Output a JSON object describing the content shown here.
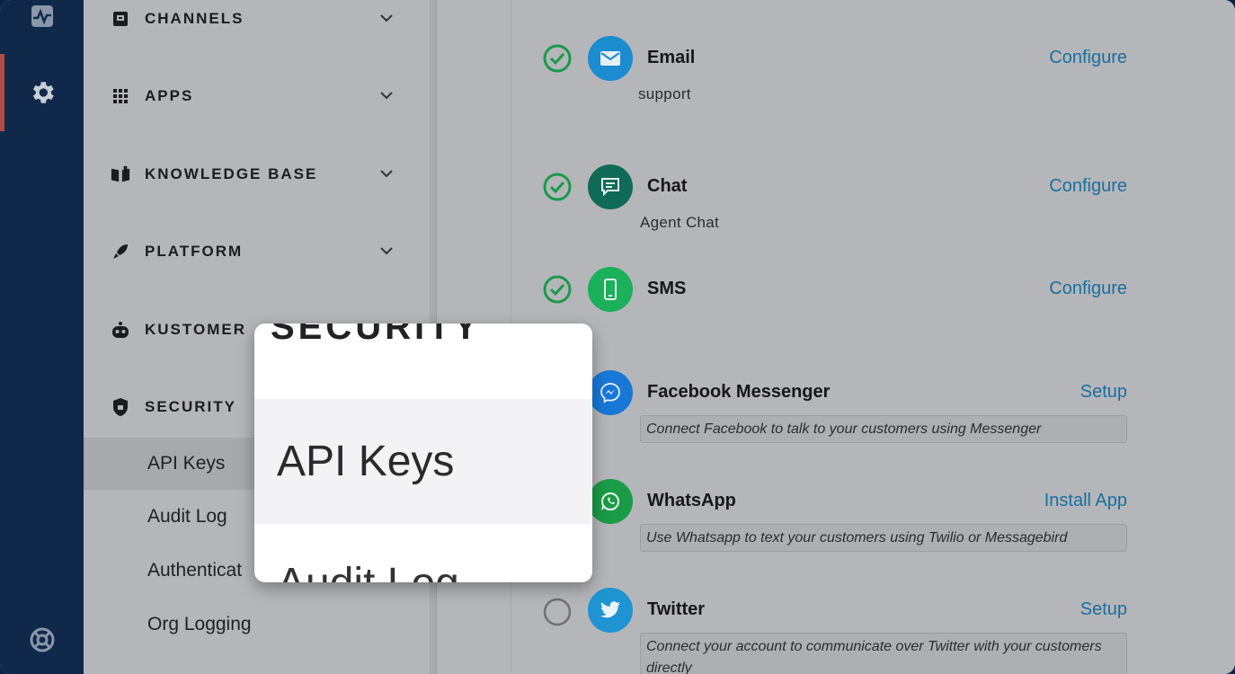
{
  "rail": {
    "items": [
      {
        "icon": "activity-icon"
      },
      {
        "icon": "gear-icon",
        "active": true
      },
      {
        "icon": "help-lifebuoy-icon"
      }
    ]
  },
  "sidebar": {
    "sections": [
      {
        "label": "CHANNELS",
        "icon": "inbox-icon"
      },
      {
        "label": "APPS",
        "icon": "grid-icon"
      },
      {
        "label": "KNOWLEDGE BASE",
        "icon": "book-icon"
      },
      {
        "label": "PLATFORM",
        "icon": "rocket-icon"
      },
      {
        "label": "KUSTOMER",
        "icon": "robot-icon"
      },
      {
        "label": "SECURITY",
        "icon": "shield-icon"
      }
    ],
    "security_items": [
      {
        "label": "API Keys",
        "active": true
      },
      {
        "label": "Audit Log"
      },
      {
        "label": "Authenticat"
      },
      {
        "label": "Org Logging"
      }
    ]
  },
  "zoom": {
    "title": "SECURITY",
    "active_item": "API Keys",
    "next_item": "Audit Log"
  },
  "channels": [
    {
      "name": "Email",
      "subtitle": "support",
      "action": "Configure",
      "status": "enabled",
      "color": "#1a8ccf",
      "icon": "mail-icon"
    },
    {
      "name": "Chat",
      "subtitle": "Agent Chat",
      "action": "Configure",
      "status": "enabled",
      "color": "#0f6b58",
      "icon": "chat-icon"
    },
    {
      "name": "SMS",
      "subtitle": "",
      "action": "Configure",
      "status": "enabled",
      "color": "#1bb05a",
      "icon": "phone-icon"
    },
    {
      "name": "Facebook Messenger",
      "description": "Connect Facebook to talk to your customers using Messenger",
      "action": "Setup",
      "status": "none",
      "color": "#1878d8",
      "icon": "messenger-icon"
    },
    {
      "name": "WhatsApp",
      "description": "Use Whatsapp to text your customers using Twilio or Messagebird",
      "action": "Install App",
      "status": "none",
      "color": "#1a9c46",
      "icon": "whatsapp-icon"
    },
    {
      "name": "Twitter",
      "description": "Connect your account to communicate over Twitter with your customers directly",
      "action": "Setup",
      "status": "disabled",
      "color": "#1e94d2",
      "icon": "twitter-icon"
    }
  ],
  "colors": {
    "rail_bg": "#10294a",
    "accent_link": "#1a6fa0",
    "check_green": "#1a9a4a"
  }
}
